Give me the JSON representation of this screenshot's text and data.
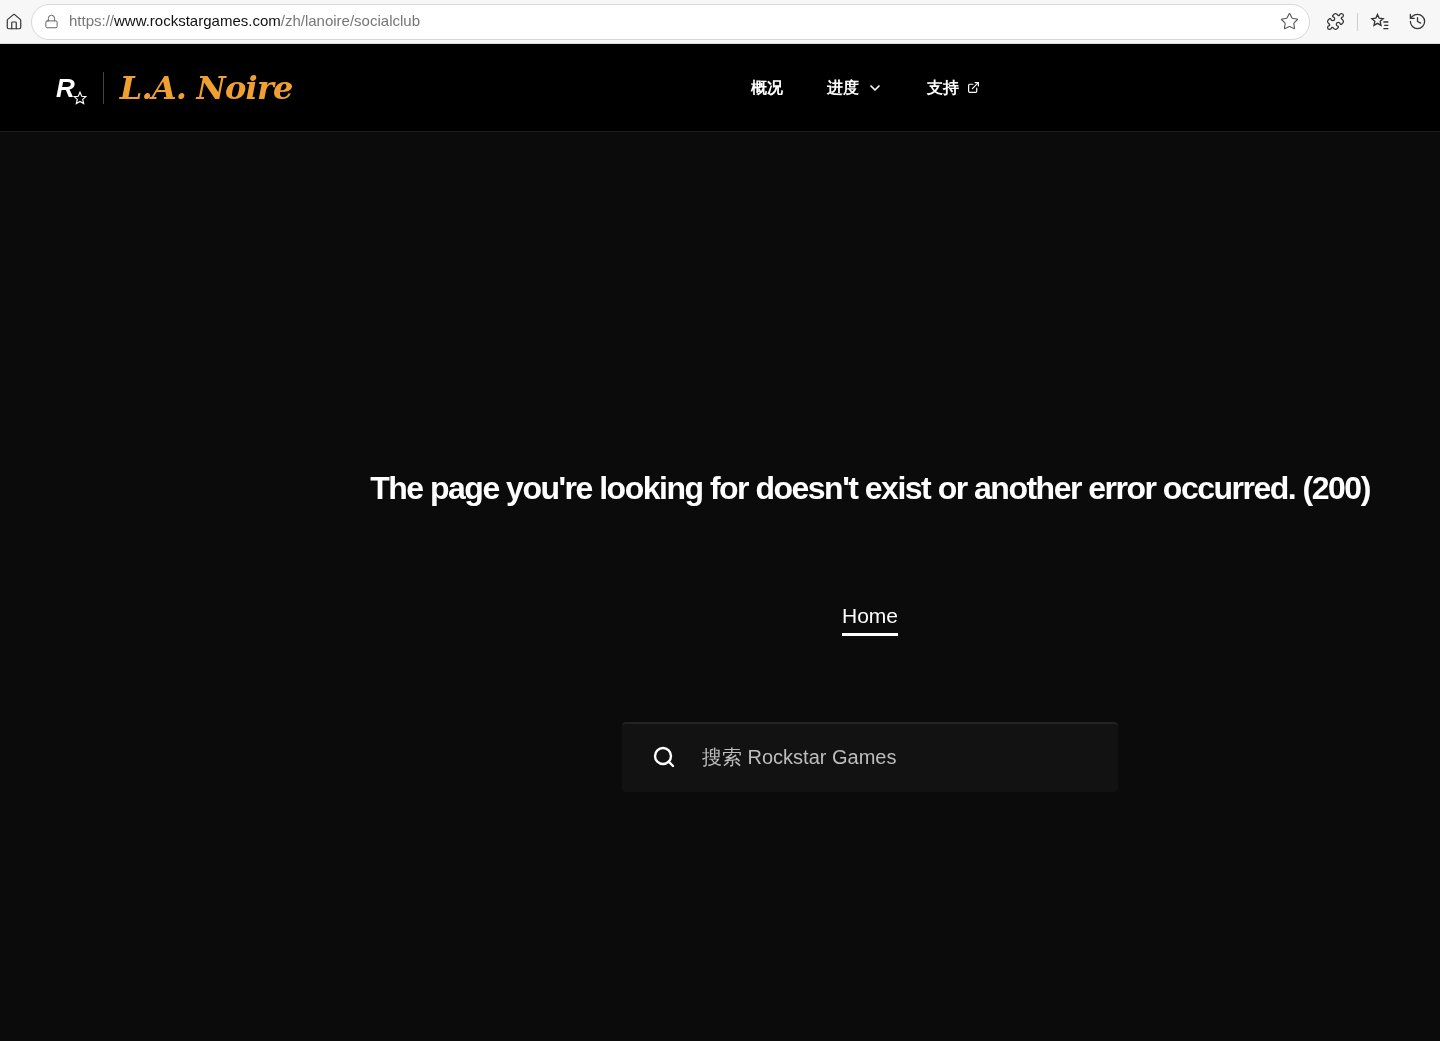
{
  "browser": {
    "url": {
      "scheme": "https://",
      "host": "www.rockstargames.com",
      "path": "/zh/lanoire/socialclub"
    }
  },
  "header": {
    "logo": {
      "mark": "R",
      "title": "L.A. Noire"
    },
    "nav": [
      {
        "label": "概况",
        "kind": "plain"
      },
      {
        "label": "进度",
        "kind": "dropdown"
      },
      {
        "label": "支持",
        "kind": "external"
      }
    ]
  },
  "error": {
    "message": "The page you're looking for doesn't exist or another error occurred. (200)",
    "home_link": "Home"
  },
  "search": {
    "placeholder": "搜索 Rockstar Games"
  }
}
